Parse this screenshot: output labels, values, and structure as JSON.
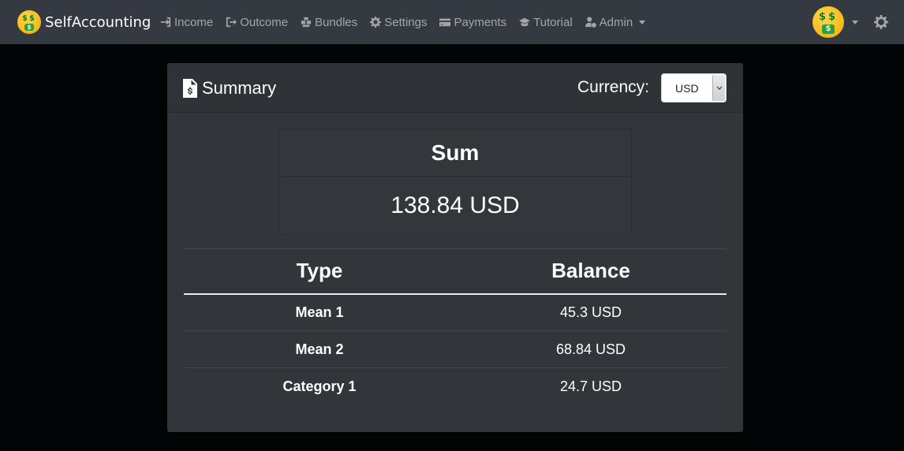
{
  "navbar": {
    "brand": "SelfAccounting",
    "brand_icon": "money-mouth-face-icon",
    "items": [
      {
        "label": "Income",
        "icon": "sign-in-icon"
      },
      {
        "label": "Outcome",
        "icon": "sign-out-icon"
      },
      {
        "label": "Bundles",
        "icon": "boxes-icon"
      },
      {
        "label": "Settings",
        "icon": "gear-icon"
      },
      {
        "label": "Payments",
        "icon": "credit-card-icon"
      },
      {
        "label": "Tutorial",
        "icon": "graduation-cap-icon"
      },
      {
        "label": "Admin",
        "icon": "user-cog-icon"
      }
    ],
    "theme_icon": "sun-icon"
  },
  "card": {
    "title": "Summary",
    "currency_label": "Currency:",
    "currency_value": "USD",
    "sum": {
      "heading": "Sum",
      "value": "138.84 USD"
    },
    "table": {
      "headers": [
        "Type",
        "Balance"
      ],
      "rows": [
        {
          "type": "Mean 1",
          "balance": "45.3 USD"
        },
        {
          "type": "Mean 2",
          "balance": "68.84 USD"
        },
        {
          "type": "Category 1",
          "balance": "24.7 USD"
        }
      ]
    }
  },
  "colors": {
    "navbar_bg": "#343a40",
    "page_bg": "#020405",
    "card_bg": "#32363b"
  }
}
